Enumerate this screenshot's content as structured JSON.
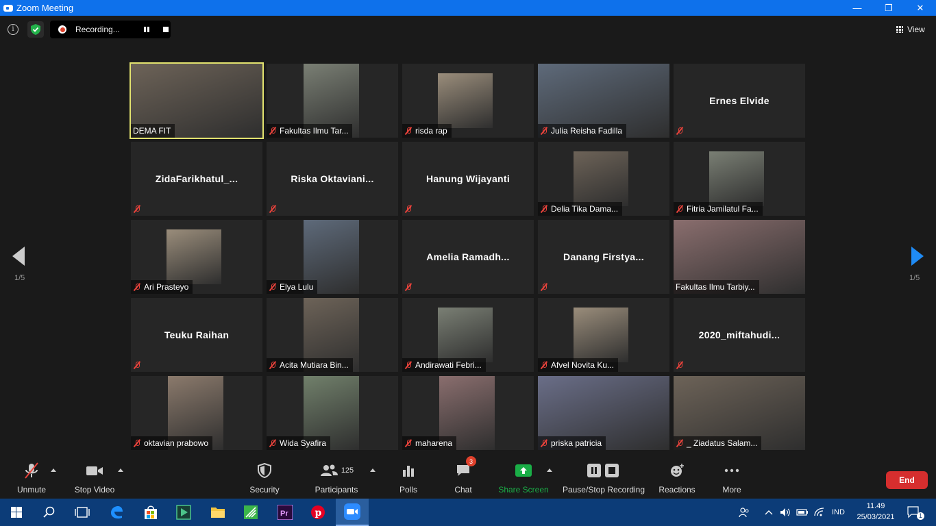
{
  "window": {
    "title": "Zoom Meeting",
    "minimize": "—",
    "maximize": "❐",
    "close": "✕"
  },
  "topbar": {
    "recording_text": "Recording...",
    "view_label": "View"
  },
  "pagination": {
    "left": "1/5",
    "right": "1/5"
  },
  "participants": [
    {
      "name": "DEMA FIT",
      "video": "full",
      "muted": false,
      "active": true
    },
    {
      "name": "Fakultas Ilmu Tar...",
      "video": "tall",
      "muted": true
    },
    {
      "name": "risda rap",
      "video": "mid",
      "muted": true
    },
    {
      "name": "Julia Reisha Fadilla",
      "video": "full",
      "muted": true
    },
    {
      "name": "Ernes Elvide",
      "video": "none",
      "muted": true
    },
    {
      "name": "ZidaFarikhatul_...",
      "video": "none",
      "muted": true
    },
    {
      "name": "Riska  Oktaviani...",
      "video": "none",
      "muted": true
    },
    {
      "name": "Hanung Wijayanti",
      "video": "none",
      "muted": true
    },
    {
      "name": "Delia Tika Dama...",
      "video": "mid",
      "muted": true
    },
    {
      "name": "Fitria Jamilatul Fa...",
      "video": "mid",
      "muted": true
    },
    {
      "name": "Ari Prasteyo",
      "video": "mid",
      "muted": true
    },
    {
      "name": "Elya Lulu",
      "video": "tall",
      "muted": true
    },
    {
      "name": "Amelia  Ramadh...",
      "video": "none",
      "muted": true
    },
    {
      "name": "Danang  Firstya...",
      "video": "none",
      "muted": true
    },
    {
      "name": "Fakultas Ilmu Tarbiy...",
      "video": "full",
      "muted": false
    },
    {
      "name": "Teuku Raihan",
      "video": "none",
      "muted": true
    },
    {
      "name": "Acita Mutiara Bin...",
      "video": "tall",
      "muted": true
    },
    {
      "name": "Andirawati Febri...",
      "video": "mid",
      "muted": true
    },
    {
      "name": "Afvel Novita Ku...",
      "video": "mid",
      "muted": true
    },
    {
      "name": "2020_miftahudi...",
      "video": "none",
      "muted": true
    },
    {
      "name": "oktavian prabowo",
      "video": "tall",
      "muted": true
    },
    {
      "name": "Wida Syafira",
      "video": "tall",
      "muted": true
    },
    {
      "name": "maharena",
      "video": "tall",
      "muted": true
    },
    {
      "name": "priska patricia",
      "video": "full",
      "muted": true
    },
    {
      "name": "_ Ziadatus Salam...",
      "video": "full",
      "muted": true
    }
  ],
  "toolbar": {
    "unmute": "Unmute",
    "stop_video": "Stop Video",
    "security": "Security",
    "participants": "Participants",
    "participants_count": "125",
    "polls": "Polls",
    "chat": "Chat",
    "chat_badge": "3",
    "share_screen": "Share Screen",
    "recording": "Pause/Stop Recording",
    "reactions": "Reactions",
    "more": "More",
    "end": "End"
  },
  "taskbar": {
    "language": "IND",
    "time": "11.49",
    "date": "25/03/2021",
    "notification_count": "1"
  },
  "colors": {
    "accent": "#0e71eb",
    "active_speaker": "#e3e36f",
    "end": "#d62e2e",
    "share": "#1aae47"
  }
}
